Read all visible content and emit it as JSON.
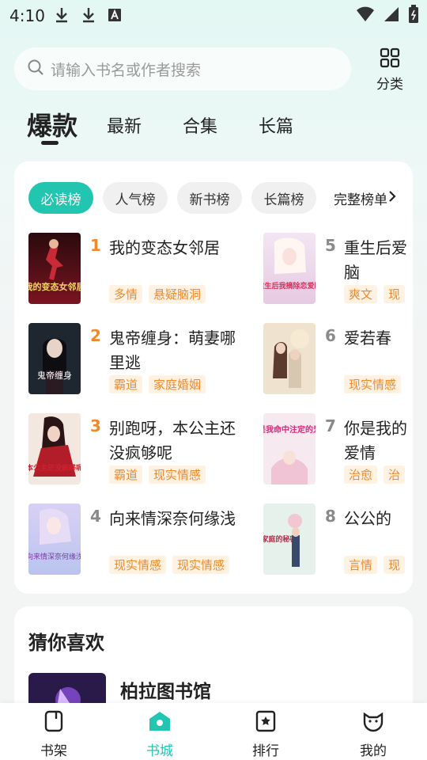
{
  "status_bar": {
    "time": "4:10",
    "left_icons": [
      "download-icon",
      "download-icon",
      "a-box-icon"
    ],
    "right_icons": [
      "wifi-icon",
      "signal-icon",
      "battery-icon"
    ]
  },
  "search": {
    "placeholder": "请输入书名或作者搜索"
  },
  "category": {
    "label": "分类"
  },
  "main_tabs": [
    {
      "label": "爆款",
      "active": true
    },
    {
      "label": "最新"
    },
    {
      "label": "合集"
    },
    {
      "label": "长篇"
    }
  ],
  "rank_chips": [
    {
      "label": "必读榜",
      "active": true
    },
    {
      "label": "人气榜"
    },
    {
      "label": "新书榜"
    },
    {
      "label": "长篇榜"
    }
  ],
  "rank_more": "完整榜单",
  "books": [
    {
      "rank": "1",
      "title": "我的变态女邻居",
      "tags": [
        "多情",
        "悬疑脑洞"
      ]
    },
    {
      "rank": "2",
      "title": "鬼帝缠身：萌妻哪里逃",
      "tags": [
        "霸道",
        "家庭婚姻"
      ]
    },
    {
      "rank": "3",
      "title": "别跑呀，本公主还没疯够呢",
      "tags": [
        "霸道",
        "现实情感"
      ]
    },
    {
      "rank": "4",
      "title": "向来情深奈何缘浅",
      "tags": [
        "现实情感",
        "现实情感"
      ]
    },
    {
      "rank": "5",
      "title": "重生后爱脑",
      "tags": [
        "爽文",
        "现"
      ]
    },
    {
      "rank": "6",
      "title": "爱若春",
      "tags": [
        "现实情感"
      ]
    },
    {
      "rank": "7",
      "title": "你是我的爱情",
      "tags": [
        "治愈",
        "治"
      ]
    },
    {
      "rank": "8",
      "title": "公公的",
      "tags": [
        "言情",
        "现"
      ]
    }
  ],
  "cover_titles": [
    "我的变态女邻居",
    "鬼帝缠身",
    "本公主还没疯够呢",
    "向来情深奈何缘浅",
    "重生后我摘除恋爱脑",
    "",
    "你是我命中注定的爱情",
    "家庭的秘密"
  ],
  "guess": {
    "title": "猜你喜欢",
    "book_name": "柏拉图书馆"
  },
  "bottom_nav": [
    {
      "label": "书架",
      "icon": "bookshelf-icon"
    },
    {
      "label": "书城",
      "icon": "bookstore-icon",
      "active": true
    },
    {
      "label": "排行",
      "icon": "ranking-icon"
    },
    {
      "label": "我的",
      "icon": "profile-icon"
    }
  ],
  "colors": {
    "accent": "#22c6b0",
    "rank_top": "#ef8a2c",
    "rank_other": "#8a8a8a",
    "tag_text": "#ef8a2c",
    "tag_bg": "#fff2e3"
  }
}
